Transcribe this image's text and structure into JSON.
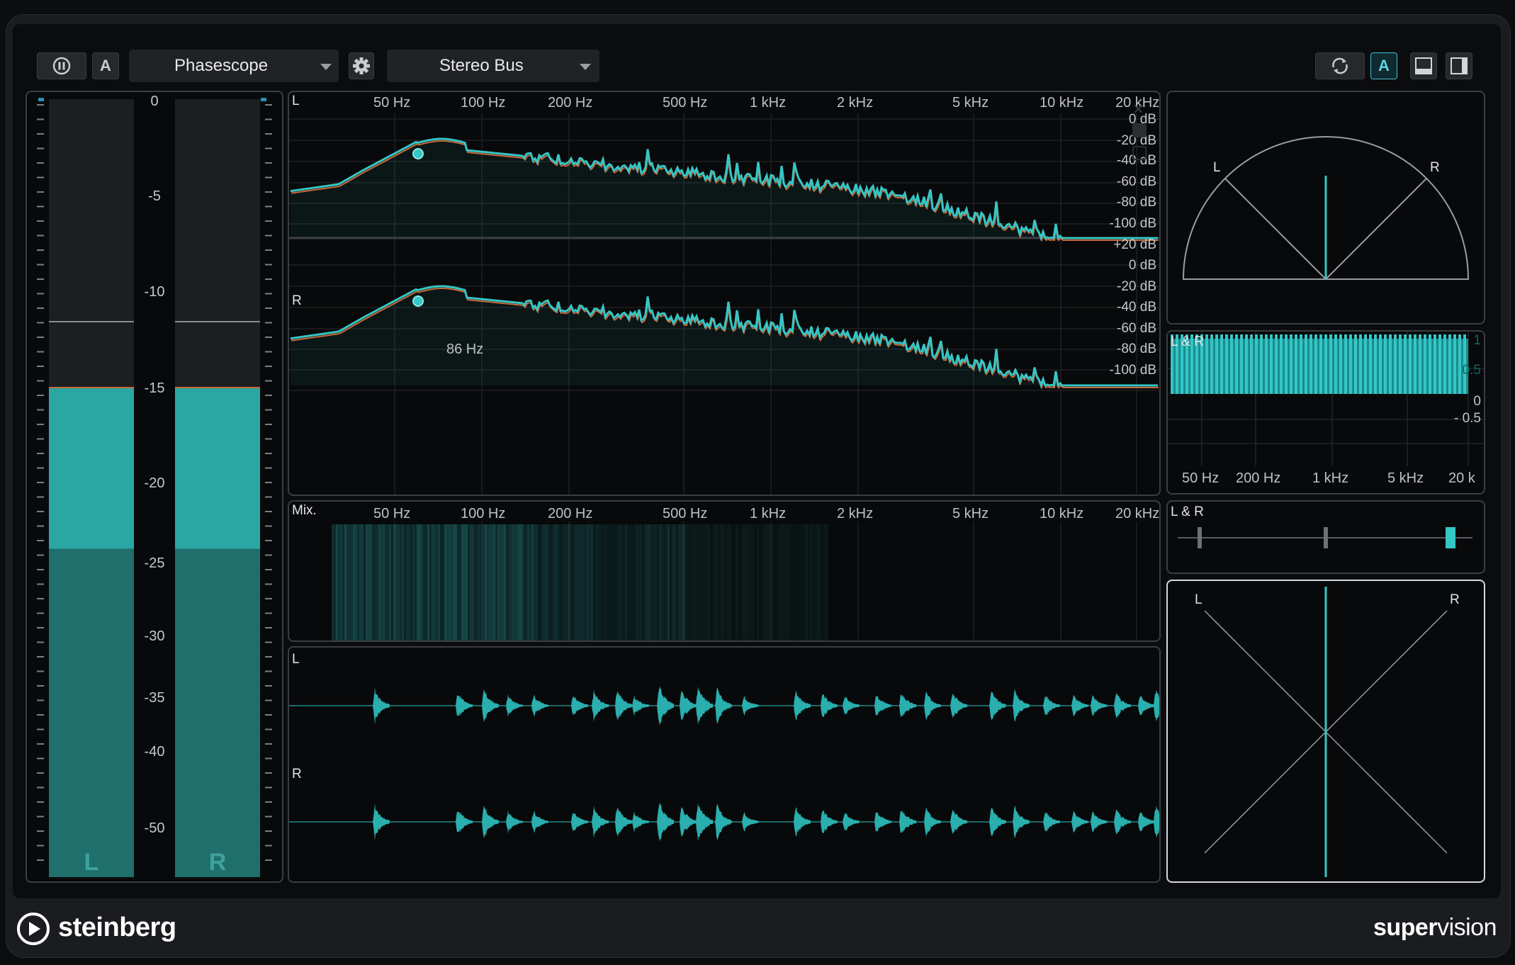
{
  "toolbar": {
    "module_name": "Phasescope",
    "bus_name": "Stereo Bus",
    "auto_label": "A",
    "active_auto_label": "A"
  },
  "level_meter": {
    "scale": [
      "0",
      "-5",
      "-10",
      "-15",
      "-20",
      "-25",
      "-30",
      "-35",
      "-40",
      "-50"
    ],
    "channels": [
      "L",
      "R"
    ],
    "fill_level": 0.63
  },
  "spectrum": {
    "channel_left": "L",
    "channel_right": "R",
    "freq_labels": [
      "50 Hz",
      "100 Hz",
      "200 Hz",
      "500 Hz",
      "1 kHz",
      "2 kHz",
      "5 kHz",
      "10 kHz",
      "20 kHz"
    ],
    "db_labels_top": [
      "0 dB",
      "-20 dB",
      "-40 dB",
      "-60 dB",
      "-80 dB",
      "-100 dB"
    ],
    "db_labels_bottom": [
      "+20 dB",
      "0 dB",
      "-20 dB",
      "-40 dB",
      "-60 dB",
      "-80 dB",
      "-100 dB"
    ],
    "marker_label": "86 Hz"
  },
  "spectrogram": {
    "label": "Mix.",
    "freq_labels": [
      "50 Hz",
      "100 Hz",
      "200 Hz",
      "500 Hz",
      "1 kHz",
      "2 kHz",
      "5 kHz",
      "10 kHz",
      "20 kHz"
    ]
  },
  "oscilloscope": {
    "channel_left": "L",
    "channel_right": "R"
  },
  "phase_meter": {
    "left": "L",
    "right": "R"
  },
  "correlation_spectrum": {
    "label": "L & R",
    "y_labels": [
      "1",
      "0.5",
      "0",
      "- 0.5"
    ],
    "freq_labels": [
      "50 Hz",
      "200 Hz",
      "1 kHz",
      "5 kHz",
      "20 k"
    ]
  },
  "balance_meter": {
    "label": "L & R"
  },
  "goniometer": {
    "left": "L",
    "right": "R"
  },
  "footer": {
    "brand": "steinberg",
    "product_super": "super",
    "product_vision": "vision"
  },
  "colors": {
    "accent": "#35c6c6",
    "meter_fill": "#2aa7a3",
    "meter_fill_dark": "#1f6f6c",
    "peak_line": "#c46a3a"
  }
}
